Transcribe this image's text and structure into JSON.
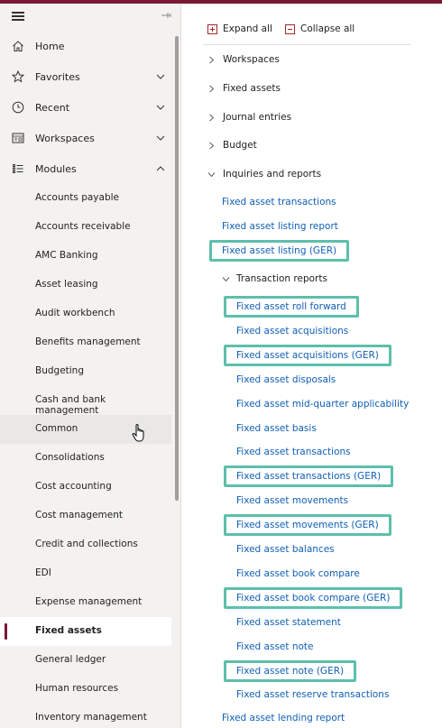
{
  "nav": {
    "items": [
      {
        "label": "Home",
        "icon": "home-icon"
      },
      {
        "label": "Favorites",
        "icon": "star-icon"
      },
      {
        "label": "Recent",
        "icon": "clock-icon"
      },
      {
        "label": "Workspaces",
        "icon": "workspaces-icon"
      },
      {
        "label": "Modules",
        "icon": "list-icon"
      }
    ],
    "modules": [
      "Accounts payable",
      "Accounts receivable",
      "AMC Banking",
      "Asset leasing",
      "Audit workbench",
      "Benefits management",
      "Budgeting",
      "Cash and bank management",
      "Common",
      "Consolidations",
      "Cost accounting",
      "Cost management",
      "Credit and collections",
      "EDI",
      "Expense management",
      "Fixed assets",
      "General ledger",
      "Human resources",
      "Inventory management"
    ],
    "selected_module": "Fixed assets",
    "hovered_module": "Common"
  },
  "toolbar": {
    "expand_all": "Expand all",
    "collapse_all": "Collapse all"
  },
  "sections": {
    "workspaces": "Workspaces",
    "fixed_assets": "Fixed assets",
    "journal_entries": "Journal entries",
    "budget": "Budget",
    "inquiries": "Inquiries and reports",
    "transaction_reports": "Transaction reports"
  },
  "inquiry_links": [
    "Fixed asset transactions",
    "Fixed asset listing report",
    "Fixed asset listing (GER)"
  ],
  "transaction_links": [
    "Fixed asset roll forward",
    "Fixed asset acquisitions",
    "Fixed asset acquisitions (GER)",
    "Fixed asset disposals",
    "Fixed asset mid-quarter applicability",
    "Fixed asset basis",
    "Fixed asset transactions",
    "Fixed asset transactions (GER)",
    "Fixed asset movements",
    "Fixed asset movements (GER)",
    "Fixed asset balances",
    "Fixed asset book compare",
    "Fixed asset book compare (GER)",
    "Fixed asset statement",
    "Fixed asset note",
    "Fixed asset note (GER)",
    "Fixed asset reserve transactions"
  ],
  "trailing_link": "Fixed asset lending report",
  "colors": {
    "accent": "#7a1836",
    "link": "#0f5fb6",
    "highlight": "#5dbfab",
    "nav_bg": "#f3f2f1"
  }
}
